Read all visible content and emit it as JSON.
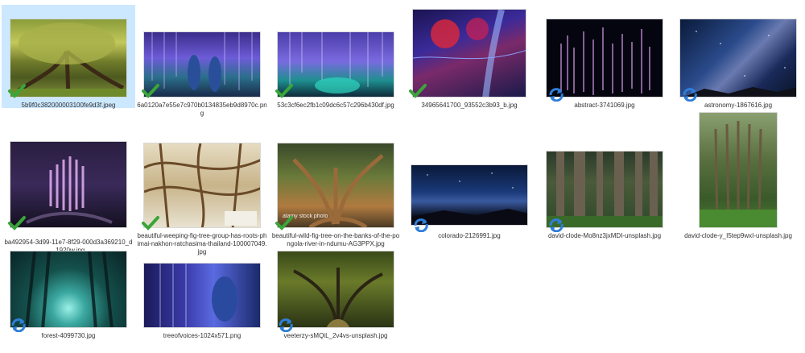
{
  "files": [
    {
      "name": "5b9f0c382000003100fe9d3f.jpeg",
      "status": "synced",
      "selected": true
    },
    {
      "name": "6a0120a7e55e7c970b0134835eb9d8970c.png",
      "status": "synced",
      "selected": false
    },
    {
      "name": "53c3cf6ec2fb1c09dc6c57c296b430df.jpg",
      "status": "synced",
      "selected": false
    },
    {
      "name": "34965641700_93552c3b93_b.jpg",
      "status": "synced",
      "selected": false
    },
    {
      "name": "abstract-3741069.jpg",
      "status": "syncing",
      "selected": false
    },
    {
      "name": "astronomy-1867616.jpg",
      "status": "syncing",
      "selected": false
    },
    {
      "name": "ba492954-3d99-11e7-8f29-000d3a369210_d_1920w.jpg",
      "status": "synced",
      "selected": false
    },
    {
      "name": "beautiful-weeping-fig-tree-group-has-roots-phimai-nakhon-ratchasima-thailand-100007049.jpg",
      "status": "synced",
      "selected": false
    },
    {
      "name": "beautiful-wild-fig-tree-on-the-banks-of-the-pongola-river-in-ndumu-AG3PPX.jpg",
      "status": "synced",
      "selected": false,
      "watermark": "alamy stock photo"
    },
    {
      "name": "colorado-2126991.jpg",
      "status": "syncing",
      "selected": false
    },
    {
      "name": "david-clode-Mo8nz3jxMDI-unsplash.jpg",
      "status": "syncing",
      "selected": false
    },
    {
      "name": "david-clode-y_I5tep9wxI-unsplash.jpg",
      "status": "syncing",
      "selected": false
    },
    {
      "name": "forest-4099730.jpg",
      "status": "syncing",
      "selected": false
    },
    {
      "name": "treeofvoices-1024x571.png",
      "status": "syncing",
      "selected": false
    },
    {
      "name": "veeterzy-sMQiL_2v4vs-unsplash.jpg",
      "status": "syncing",
      "selected": false
    }
  ],
  "colors": {
    "selection": "#cce8ff",
    "synced_check": "#3aa53a",
    "syncing_arrows": "#2f7fd8"
  }
}
